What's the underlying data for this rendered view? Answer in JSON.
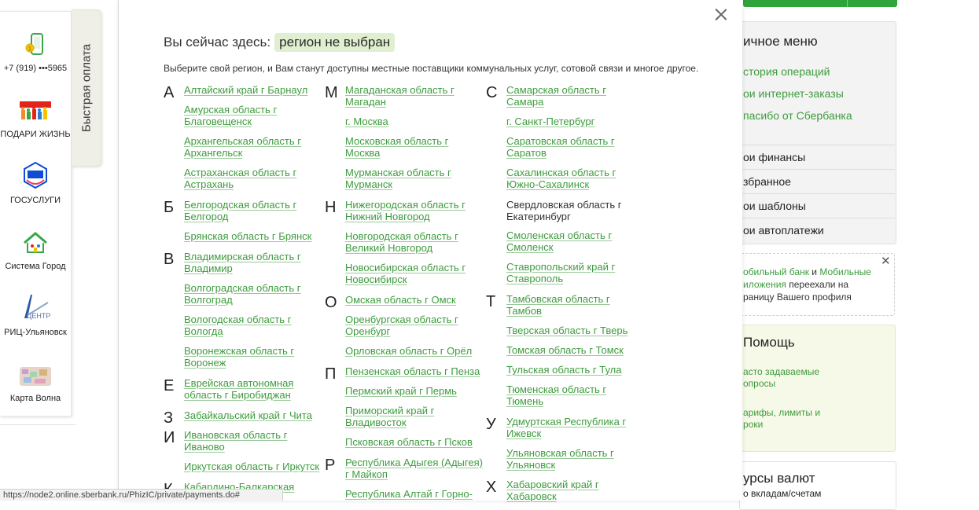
{
  "left_panel": {
    "items": [
      {
        "label": "+7 (919) •••5965",
        "icon": "mobile-phone-icon"
      },
      {
        "label": "ПОДАРИ ЖИЗНЬ",
        "icon": "podari-zhizn-logo-icon"
      },
      {
        "label": "ГОСУСЛУГИ",
        "icon": "gosuslugi-logo-icon"
      },
      {
        "label": "Система Город",
        "icon": "sistema-gorod-logo-icon"
      },
      {
        "label": "РИЦ-Ульяновск",
        "icon": "ric-center-logo-icon"
      },
      {
        "label": "Карта Волна",
        "icon": "volna-card-icon"
      }
    ],
    "quick_pay_tab": "Быстрая оплата"
  },
  "modal": {
    "heading_prefix": "Вы сейчас здесь:",
    "current_region": "регион не выбран",
    "subtitle": "Выберите свой регион, и Вам станут доступны местные поставщики коммунальных услуг, сотовой связи и многое другое.",
    "columns": [
      {
        "letters": [
          "А",
          "Б",
          "В",
          "Е",
          "З",
          "И",
          "К"
        ],
        "regions": [
          [
            "Алтайский край г Барнаул"
          ],
          [
            "Амурская область г",
            "Благовещенск"
          ],
          [
            "Архангельская область г",
            "Архангельск"
          ],
          [
            "Астраханская область г",
            "Астрахань"
          ],
          [
            "Белгородская область г",
            "Белгород"
          ],
          [
            "Брянская область г Брянск"
          ],
          [
            "Владимирская область г",
            "Владимир"
          ],
          [
            "Волгоградская область г",
            "Волгоград"
          ],
          [
            "Вологодская область г",
            "Вологда"
          ],
          [
            "Воронежская область г",
            "Воронеж"
          ],
          [
            "Еврейская автономная",
            "область г Биробиджан"
          ],
          [
            "Забайкальский край г Чита"
          ],
          [
            "Ивановская область г",
            "Иваново"
          ],
          [
            "Иркутская область г Иркутск"
          ],
          [
            "Кабардино-Балкарская"
          ]
        ]
      },
      {
        "letters": [
          "М",
          "Н",
          "О",
          "П",
          "Р"
        ],
        "regions": [
          [
            "Магаданская область г",
            "Магадан"
          ],
          [
            "г. Москва"
          ],
          [
            "Московская область г",
            "Москва"
          ],
          [
            "Мурманская область г",
            "Мурманск"
          ],
          [
            "Нижегородская область г",
            "Нижний Новгород"
          ],
          [
            "Новгородская область г",
            "Великий Новгород"
          ],
          [
            "Новосибирская область г",
            "Новосибирск"
          ],
          [
            "Омская область г Омск"
          ],
          [
            "Оренбургская область г",
            "Оренбург"
          ],
          [
            "Орловская область г Орёл"
          ],
          [
            "Пензенская область г Пенза"
          ],
          [
            "Пермский край г Пермь"
          ],
          [
            "Приморский край г",
            "Владивосток"
          ],
          [
            "Псковская область г Псков"
          ],
          [
            "Республика Адыгея (Адыгея)",
            "г Майкоп"
          ],
          [
            "Республика Алтай г Горно-"
          ]
        ]
      },
      {
        "letters": [
          "С",
          "Т",
          "У",
          "Х"
        ],
        "regions": [
          [
            "Самарская область г",
            "Самара"
          ],
          [
            "г. Санкт-Петербург"
          ],
          [
            "Саратовская область г",
            "Саратов"
          ],
          [
            "Сахалинская область г",
            "Южно-Сахалинск"
          ],
          [
            "Свердловская область г",
            "Екатеринбург"
          ],
          [
            "Смоленская область г",
            "Смоленск"
          ],
          [
            "Ставропольский край г",
            "Ставрополь"
          ],
          [
            "Тамбовская область г",
            "Тамбов"
          ],
          [
            "Тверская область г Тверь"
          ],
          [
            "Томская область г Томск"
          ],
          [
            "Тульская область г Тула"
          ],
          [
            "Тюменская область г",
            "Тюмень"
          ],
          [
            "Удмуртская Республика г",
            "Ижевск"
          ],
          [
            "Ульяновская область г",
            "Ульяновск"
          ],
          [
            "Хабаровский край г",
            "Хабаровск"
          ]
        ]
      }
    ]
  },
  "right_sidebar": {
    "menu_title": "ичное меню",
    "links": [
      "стория операций",
      "ои интернет-заказы",
      "пасибо от Сбербанка"
    ],
    "menu_items": [
      "ои финансы",
      "збранное",
      "ои шаблоны",
      "ои автоплатежи"
    ],
    "notice": {
      "link1": "обильный банк",
      "and": " и ",
      "link2": "Мобильные",
      "link2_cont": "иложения",
      "text1": " переехали на",
      "text2": "раницу Вашего профиля"
    },
    "help": {
      "title": "Помощь",
      "faq_line1": "асто задаваемые",
      "faq_line2": "опросы",
      "tariffs_line1": "арифы, лимиты и",
      "tariffs_line2": "роки"
    },
    "rates": {
      "title": "урсы валют",
      "subtitle": "о вкладам/счетам"
    }
  },
  "status_bar": {
    "url": "https://node2.online.sberbank.ru/PhizIC/private/payments.do#"
  },
  "colors": {
    "link_green": "#3e9c3e",
    "region_badge_bg": "#dfefcf",
    "brand_green": "#2fa43b"
  }
}
